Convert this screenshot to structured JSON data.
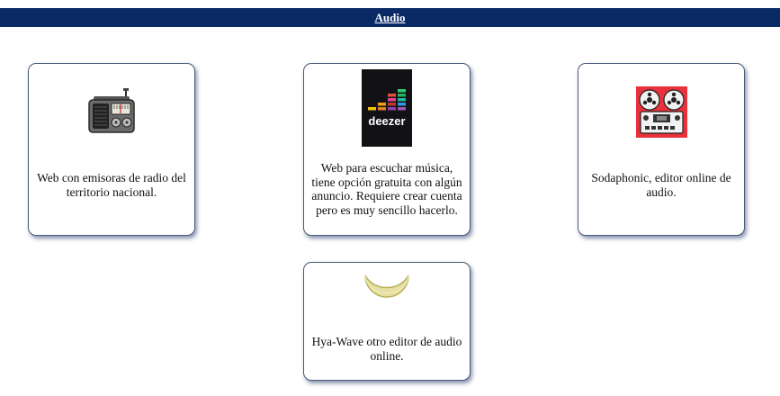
{
  "header": {
    "title": "Audio",
    "background_color": "#0a2a66"
  },
  "cards": [
    {
      "icon": "radio-icon",
      "description": "Web con emisoras de radio del territorio nacional."
    },
    {
      "icon": "deezer-logo-icon",
      "logo_text": "deezer",
      "description": "Web para escuchar música, tiene opción gratuita con algún anuncio. Requiere crear cuenta pero es muy sencillo hacerlo."
    },
    {
      "icon": "reel-to-reel-tape-icon",
      "description": "Sodaphonic, editor online de audio."
    },
    {
      "icon": "crescent-moon-icon",
      "description": "Hya-Wave otro editor de audio online."
    }
  ]
}
